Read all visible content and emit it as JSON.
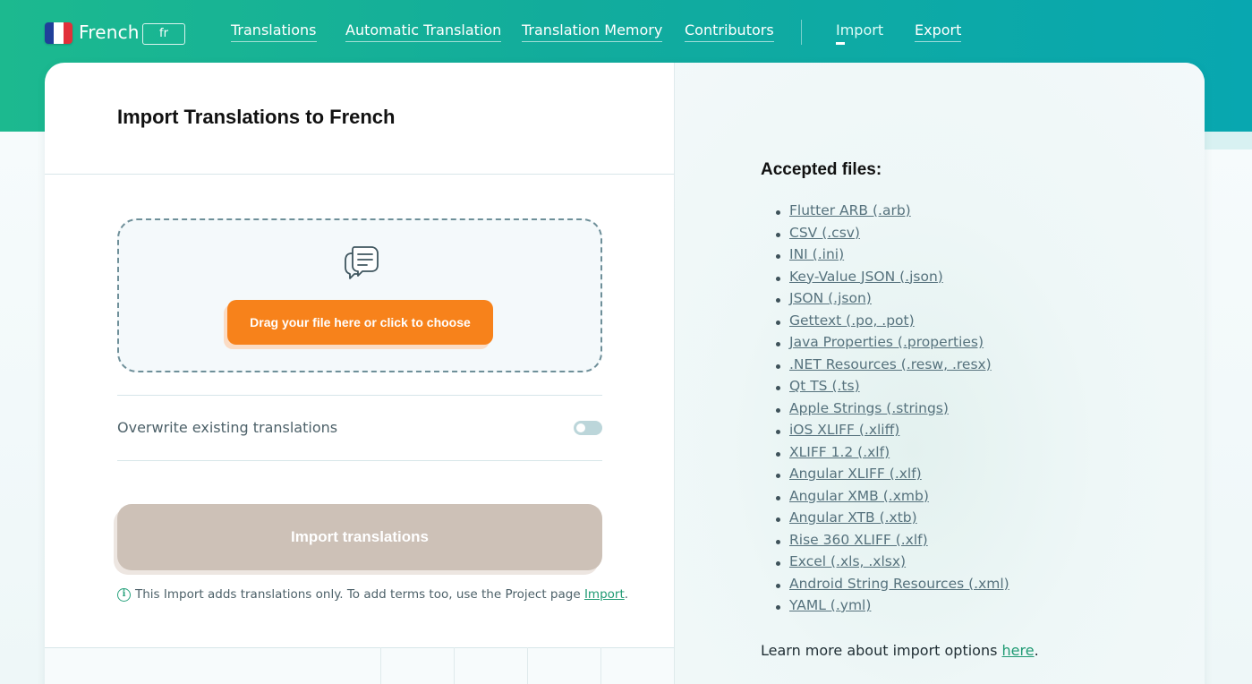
{
  "header": {
    "language_name": "French",
    "language_code": "fr",
    "nav": [
      {
        "label": "Translations"
      },
      {
        "label": "Automatic Translation"
      },
      {
        "label": "Translation Memory"
      },
      {
        "label": "Contributors"
      },
      {
        "label": "Import",
        "active": true
      },
      {
        "label": "Export"
      }
    ]
  },
  "import_panel": {
    "title": "Import Translations to French",
    "dropzone_button": "Drag your file here or click to choose",
    "overwrite_label": "Overwrite existing translations",
    "overwrite_enabled": false,
    "import_button": "Import translations",
    "note_text": "This Import adds translations only. To add terms too, use the Project page ",
    "note_link": "Import",
    "note_end": "."
  },
  "accepted_files": {
    "title": "Accepted files:",
    "items": [
      "Flutter ARB (.arb)",
      "CSV (.csv)",
      "INI (.ini)",
      "Key-Value JSON (.json)",
      "JSON (.json)",
      "Gettext (.po, .pot)",
      "Java Properties (.properties)",
      ".NET Resources (.resw, .resx)",
      "Qt TS (.ts)",
      "Apple Strings (.strings)",
      "iOS XLIFF (.xliff)",
      "XLIFF 1.2 (.xlf)",
      "Angular XLIFF (.xlf)",
      "Angular XMB (.xmb)",
      "Angular XTB (.xtb)",
      "Rise 360 XLIFF (.xlf)",
      "Excel (.xls, .xlsx)",
      "Android String Resources (.xml)",
      "YAML (.yml)"
    ],
    "learn_more_text": "Learn more about import options ",
    "learn_more_link": "here",
    "learn_more_end": "."
  },
  "colors": {
    "brand_green": "#1cb98f",
    "brand_teal": "#08a7b0",
    "upload_orange": "#f7821b",
    "disabled_button": "#cdc1b7",
    "link_green": "#1f9a73"
  },
  "icons": [
    "flag-fr-icon",
    "document-chat-icon",
    "info-icon"
  ]
}
